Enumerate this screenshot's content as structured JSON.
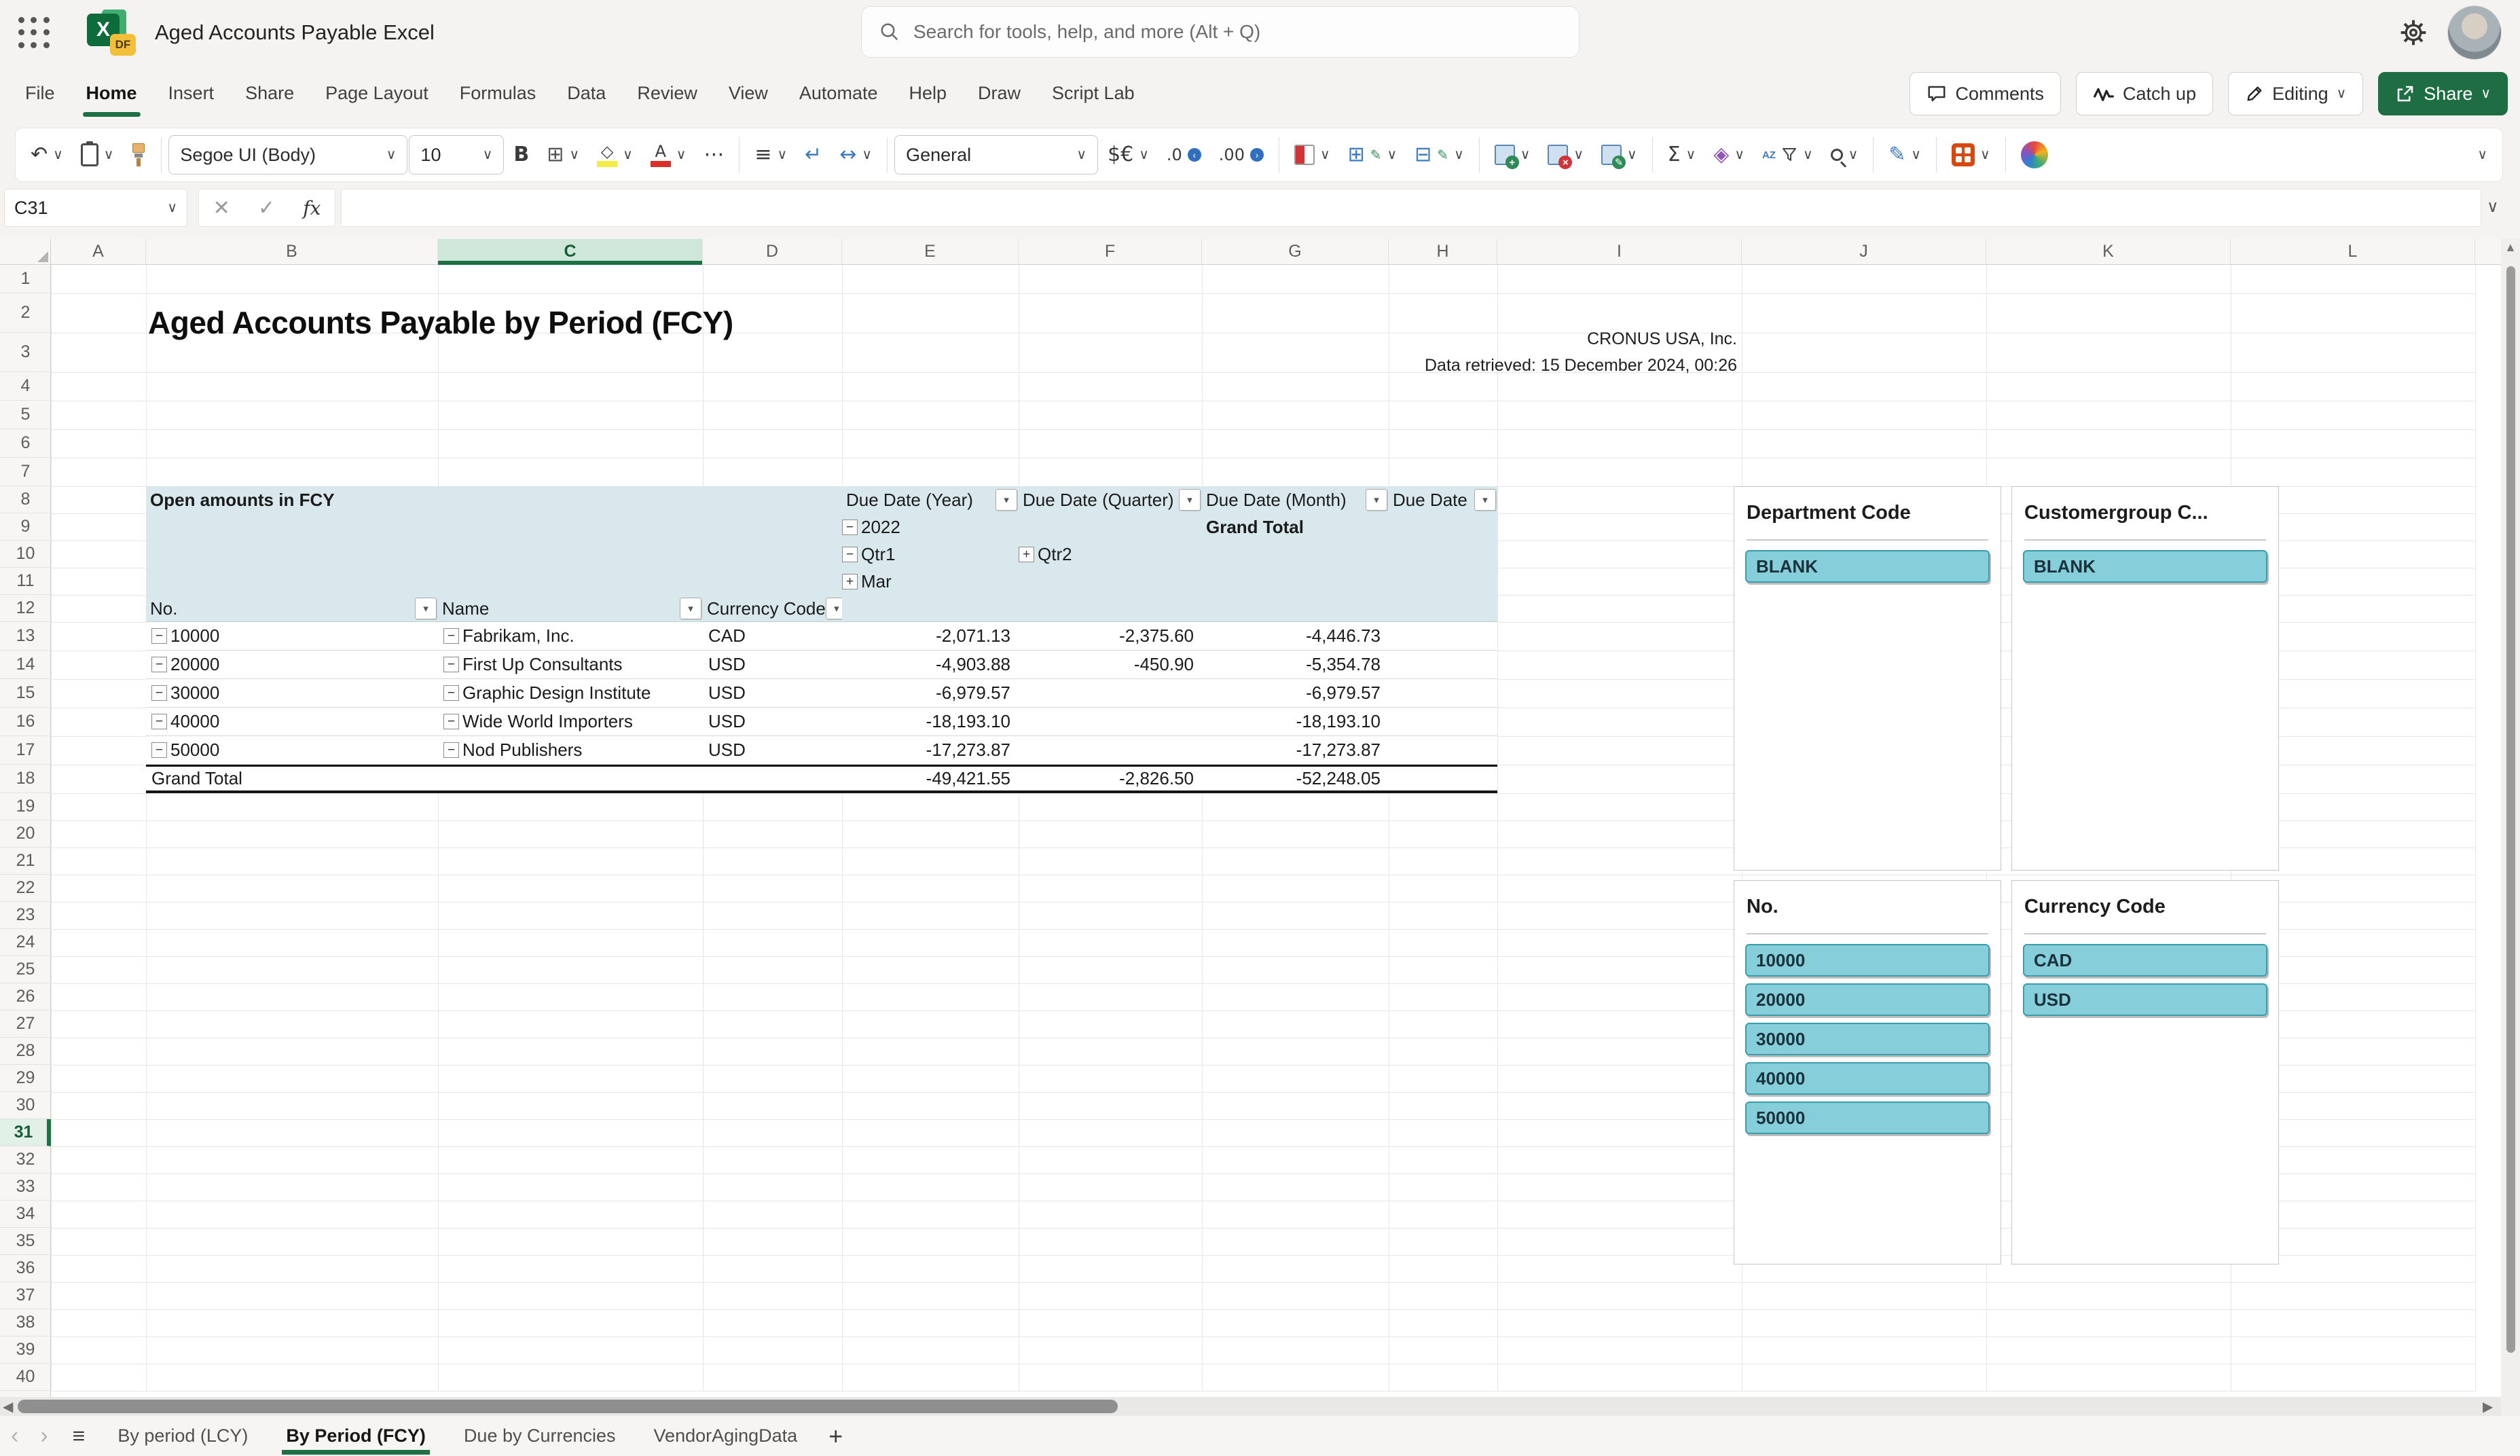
{
  "suite_header": {
    "title": "Aged Accounts Payable Excel",
    "search_placeholder": "Search for tools, help, and more (Alt + Q)",
    "app_icon_letter": "X",
    "app_icon_badge": "DF"
  },
  "ribbon": {
    "tabs": [
      "File",
      "Home",
      "Insert",
      "Share",
      "Page Layout",
      "Formulas",
      "Data",
      "Review",
      "View",
      "Automate",
      "Help",
      "Draw",
      "Script Lab"
    ],
    "active_tab": "Home",
    "comments_label": "Comments",
    "catchup_label": "Catch up",
    "editing_label": "Editing",
    "share_label": "Share"
  },
  "toolbar": {
    "font_name": "Segoe UI (Body)",
    "font_size": "10",
    "bold_label": "B",
    "number_format": "General",
    "currency_label": "$€",
    "decrease_decimal_label": ".0",
    "increase_decimal_label": ".00",
    "autosum_label": "Σ",
    "font_color_letter": "A",
    "sort_letters": "AZ"
  },
  "formula_bar": {
    "cell_ref": "C31",
    "fx_label": "fx",
    "formula": ""
  },
  "grid": {
    "columns": [
      "A",
      "B",
      "C",
      "D",
      "E",
      "F",
      "G",
      "H",
      "I",
      "J",
      "K",
      "L"
    ],
    "selected_column": "C",
    "selected_row": 31,
    "row_count": 40,
    "title": "Aged Accounts Payable by Period (FCY)",
    "company": "CRONUS USA, Inc.",
    "retrieved": "Data retrieved: 15 December 2024, 00:26"
  },
  "pivot": {
    "caption": "Open amounts in FCY",
    "column_fields": [
      "Due Date (Year)",
      "Due Date (Quarter)",
      "Due Date (Month)",
      "Due Date"
    ],
    "year_label": "2022",
    "grand_total_header": "Grand Total",
    "q1_label": "Qtr1",
    "q2_label": "Qtr2",
    "month_label": "Mar",
    "row_fields": [
      "No.",
      "Name",
      "Currency Code"
    ],
    "rows": [
      {
        "no": "10000",
        "name": "Fabrikam, Inc.",
        "currency": "CAD",
        "qtr1": "-2,071.13",
        "qtr2": "-2,375.60",
        "total": "-4,446.73"
      },
      {
        "no": "20000",
        "name": "First Up Consultants",
        "currency": "USD",
        "qtr1": "-4,903.88",
        "qtr2": "-450.90",
        "total": "-5,354.78"
      },
      {
        "no": "30000",
        "name": "Graphic Design Institute",
        "currency": "USD",
        "qtr1": "-6,979.57",
        "qtr2": "",
        "total": "-6,979.57"
      },
      {
        "no": "40000",
        "name": "Wide World Importers",
        "currency": "USD",
        "qtr1": "-18,193.10",
        "qtr2": "",
        "total": "-18,193.10"
      },
      {
        "no": "50000",
        "name": "Nod Publishers",
        "currency": "USD",
        "qtr1": "-17,273.87",
        "qtr2": "",
        "total": "-17,273.87"
      }
    ],
    "grand_total": {
      "label": "Grand Total",
      "qtr1": "-49,421.55",
      "qtr2": "-2,826.50",
      "total": "-52,248.05"
    }
  },
  "slicers": [
    {
      "title": "Department Code",
      "items": [
        "BLANK"
      ]
    },
    {
      "title": "Customergroup C...",
      "items": [
        "BLANK"
      ]
    },
    {
      "title": "No.",
      "items": [
        "10000",
        "20000",
        "30000",
        "40000",
        "50000"
      ]
    },
    {
      "title": "Currency Code",
      "items": [
        "CAD",
        "USD"
      ]
    }
  ],
  "sheet_bar": {
    "tabs": [
      "By period (LCY)",
      "By Period (FCY)",
      "Due by Currencies",
      "VendorAgingData"
    ],
    "active_tab": "By Period (FCY)"
  },
  "colors": {
    "accent_green": "#1e7145",
    "share_green": "#1f6e43",
    "pivot_header_bg": "#d9e8ec",
    "slicer_fill": "#85ceda",
    "slicer_border": "#3a9dab"
  }
}
